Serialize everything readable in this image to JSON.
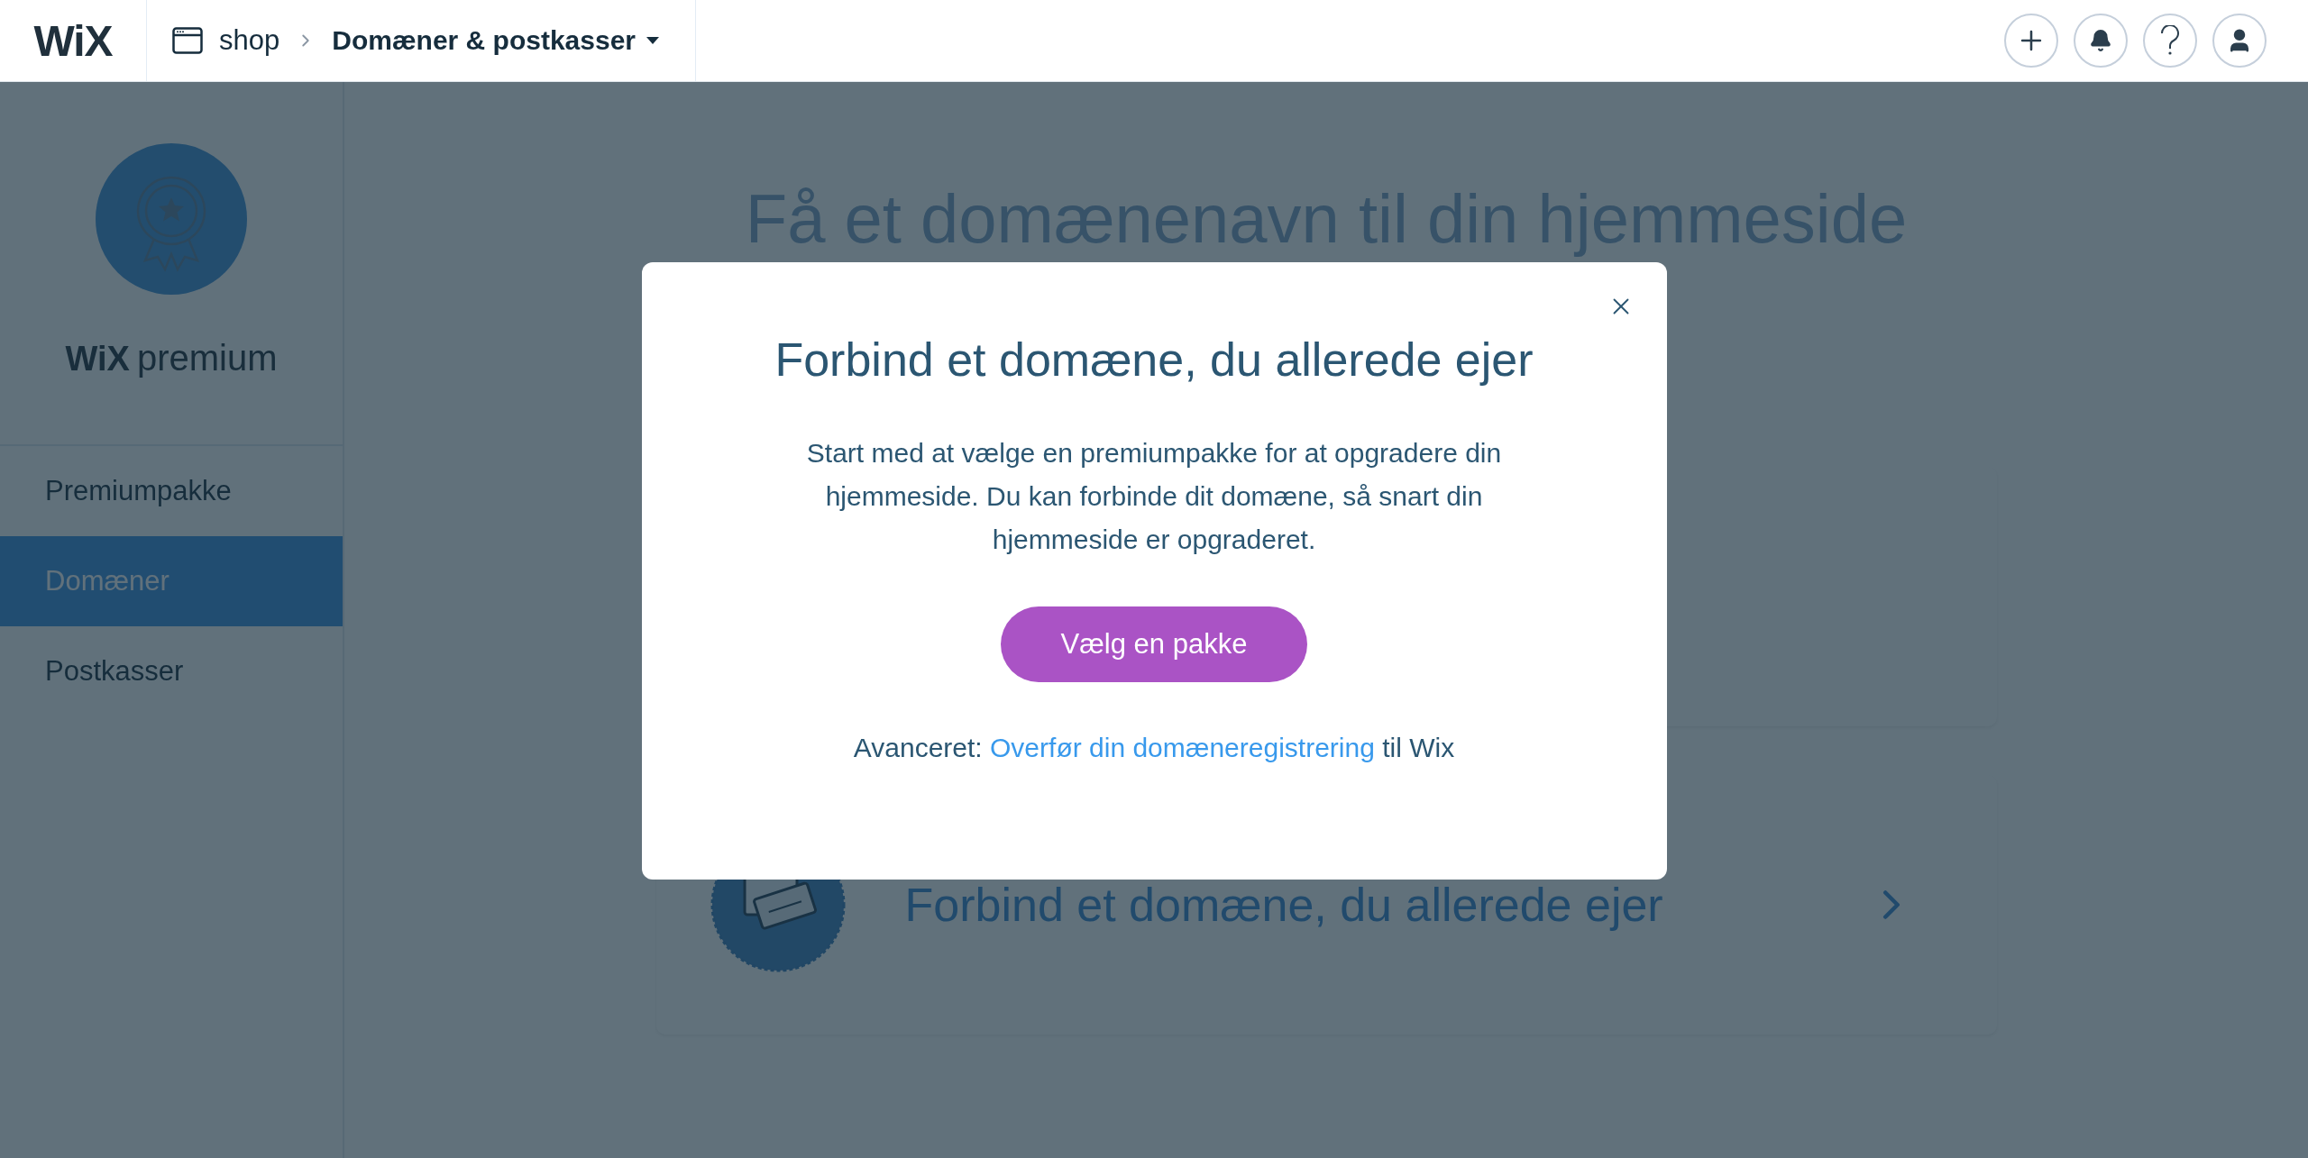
{
  "topbar": {
    "logo": "WiX",
    "breadcrumb": [
      {
        "label": "shop"
      },
      {
        "label": "Domæner & postkasser",
        "dropdown": true
      }
    ]
  },
  "sidebar": {
    "brand": "WiX",
    "brand_suffix": "premium",
    "items": [
      {
        "label": "Premiumpakke",
        "selected": false
      },
      {
        "label": "Domæner",
        "selected": true
      },
      {
        "label": "Postkasser",
        "selected": false
      }
    ]
  },
  "main": {
    "heading": "Få et domænenavn til din hjemmeside",
    "cards": [
      {
        "kind": "blank"
      },
      {
        "kind": "titled",
        "title": "Forbind et domæne, du allerede ejer"
      }
    ]
  },
  "modal": {
    "title": "Forbind et domæne, du allerede ejer",
    "body": "Start med at vælge en premiumpakke for at opgradere din hjemmeside. Du kan forbinde dit domæne, så snart din hjemmeside er opgraderet.",
    "button": "Vælg en pakke",
    "footer": {
      "prefix": "Avanceret:",
      "link": "Overfør din domæneregistrering",
      "suffix": "til Wix"
    }
  }
}
